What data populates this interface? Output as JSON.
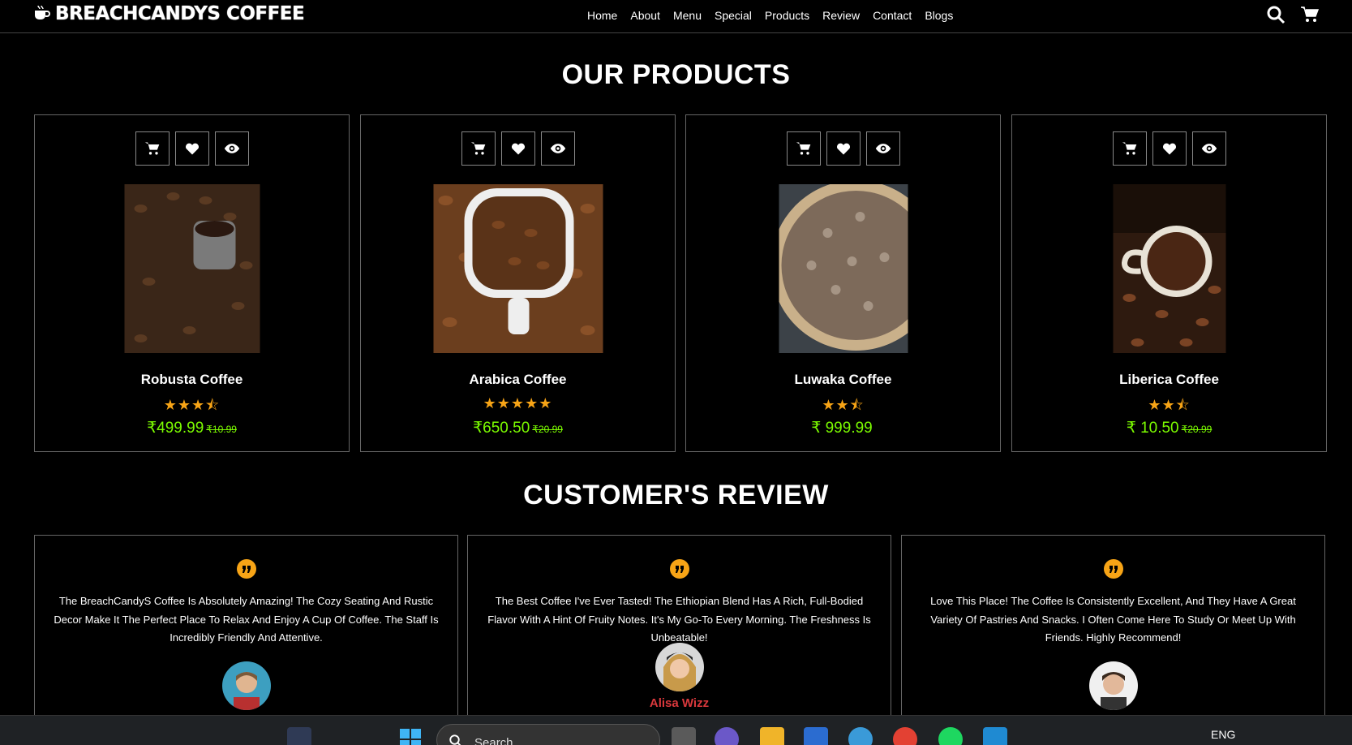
{
  "header": {
    "brand": "BREACHCANDYS COFFEE",
    "nav": [
      "Home",
      "About",
      "Menu",
      "Special",
      "Products",
      "Review",
      "Contact",
      "Blogs"
    ]
  },
  "products_section": {
    "title": "OUR PRODUCTS",
    "items": [
      {
        "name": "Robusta Coffee",
        "rating": 3.5,
        "stars": "★★★⯪",
        "price": "₹499.99",
        "old_price": "₹10.99"
      },
      {
        "name": "Arabica Coffee",
        "rating": 5,
        "stars": "★★★★★",
        "price": "₹650.50",
        "old_price": "₹20.99"
      },
      {
        "name": "Luwaka Coffee",
        "rating": 2.5,
        "stars": "★★⯪",
        "price": "₹ 999.99",
        "old_price": ""
      },
      {
        "name": "Liberica Coffee",
        "rating": 2.5,
        "stars": "★★⯪",
        "price": "₹ 10.50",
        "old_price": "₹20.99"
      }
    ]
  },
  "reviews_section": {
    "title": "CUSTOMER'S REVIEW",
    "items": [
      {
        "text": "The BreachCandyS Coffee Is Absolutely Amazing! The Cozy Seating And Rustic Decor Make It The Perfect Place To Relax And Enjoy A Cup Of Coffee. The Staff Is Incredibly Friendly And Attentive.",
        "name": ""
      },
      {
        "text": "The Best Coffee I've Ever Tasted! The Ethiopian Blend Has A Rich, Full-Bodied Flavor With A Hint Of Fruity Notes. It's My Go-To Every Morning. The Freshness Is Unbeatable!",
        "name": "Alisa Wizz"
      },
      {
        "text": "Love This Place! The Coffee Is Consistently Excellent, And They Have A Great Variety Of Pastries And Snacks. I Often Come Here To Study Or Meet Up With Friends. Highly Recommend!",
        "name": ""
      }
    ]
  },
  "taskbar": {
    "search_placeholder": "Search",
    "language": "ENG"
  },
  "colors": {
    "price": "#7cfc00",
    "stars": "#f7a416",
    "quote": "#f7a416",
    "reviewer_name": "#d9383c"
  }
}
